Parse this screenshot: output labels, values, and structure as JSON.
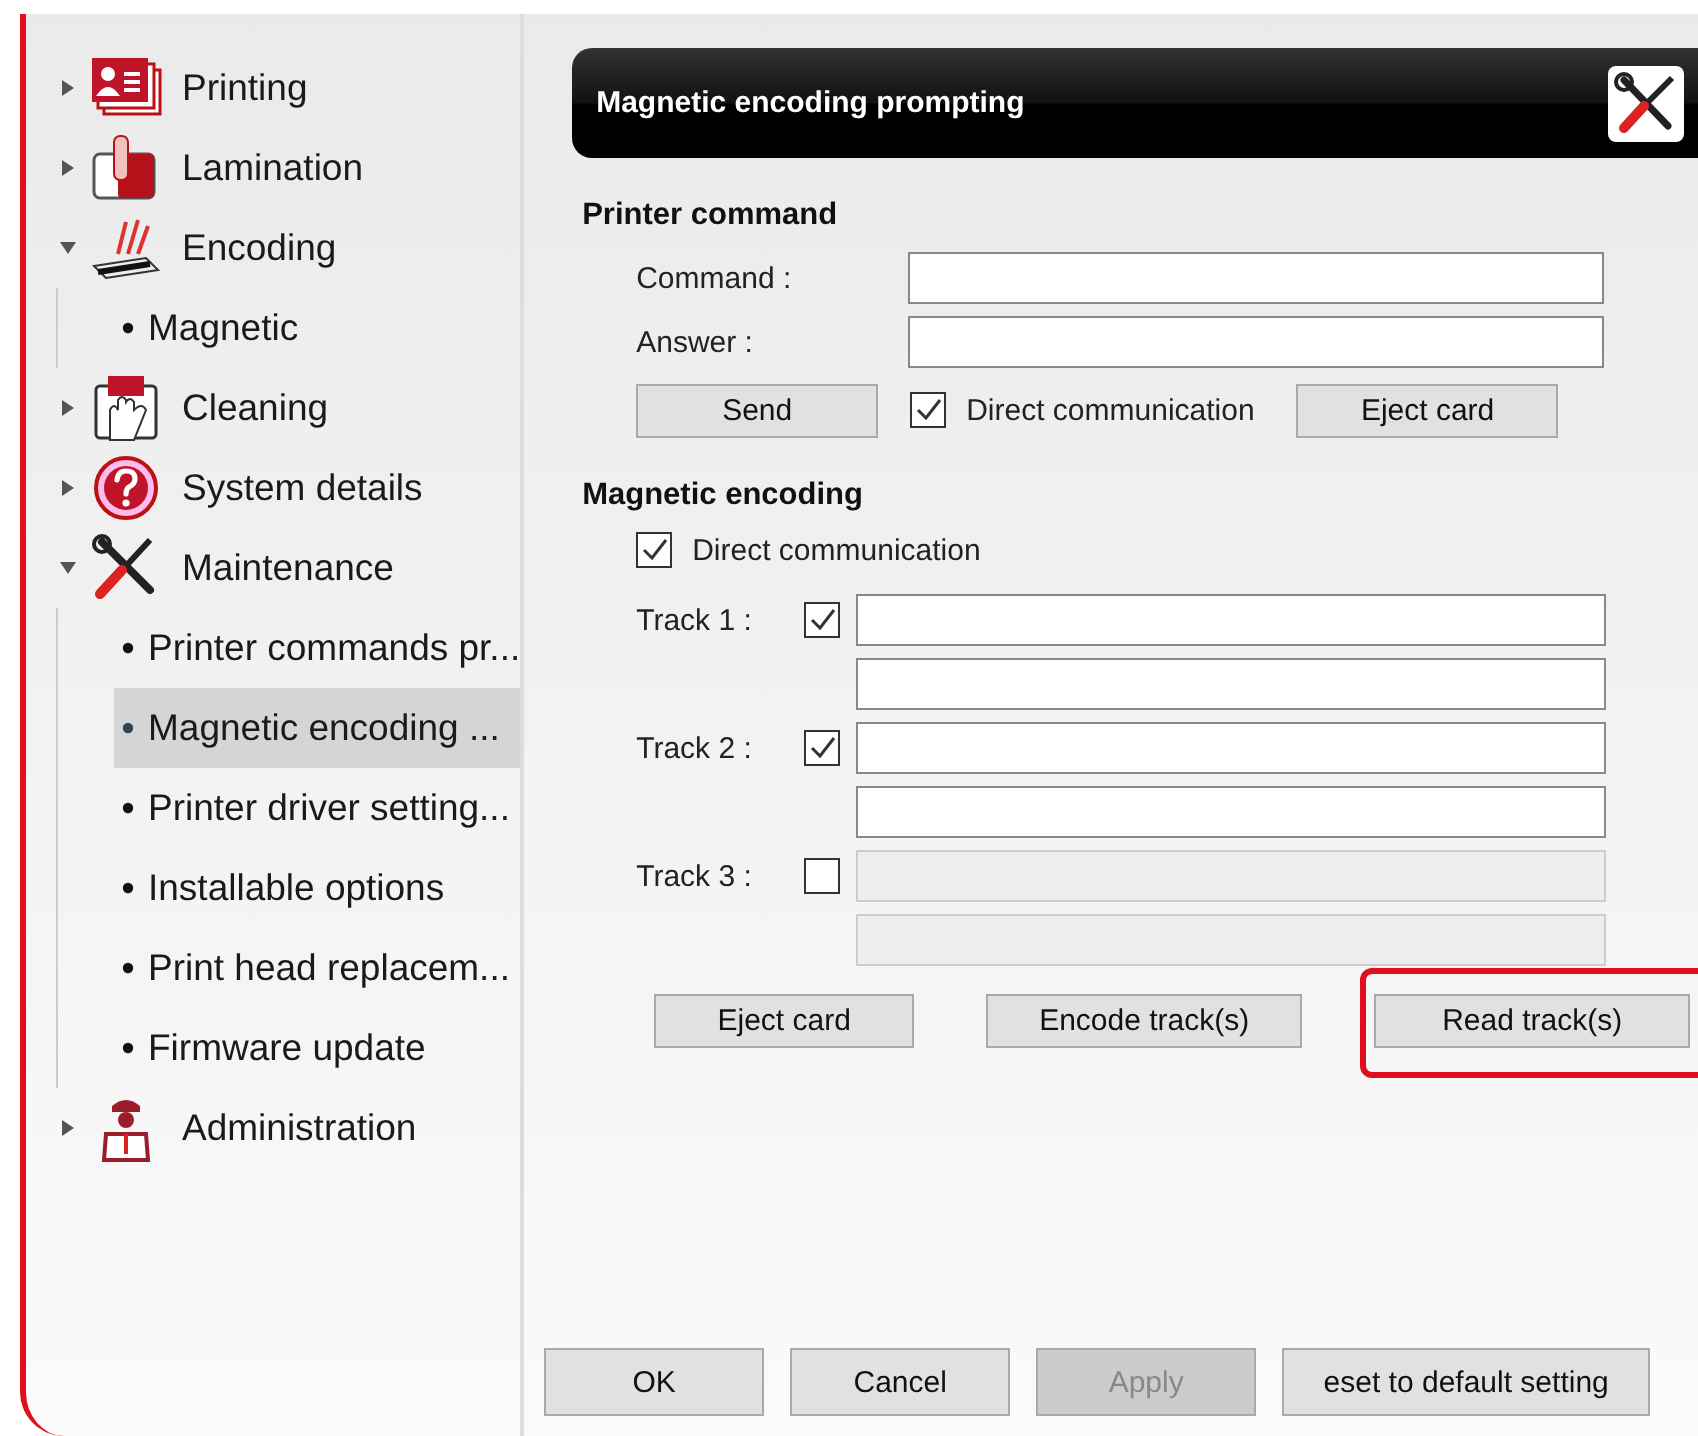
{
  "tree": [
    {
      "label": "Printing",
      "expanded": false
    },
    {
      "label": "Lamination",
      "expanded": false
    },
    {
      "label": "Encoding",
      "expanded": true,
      "children": [
        {
          "label": "Magnetic",
          "selected": false
        }
      ]
    },
    {
      "label": "Cleaning",
      "expanded": false
    },
    {
      "label": "System details",
      "expanded": false
    },
    {
      "label": "Maintenance",
      "expanded": true,
      "children": [
        {
          "label": "Printer commands pr...",
          "selected": false
        },
        {
          "label": "Magnetic encoding ...",
          "selected": true
        },
        {
          "label": "Printer driver setting...",
          "selected": false
        },
        {
          "label": "Installable options",
          "selected": false
        },
        {
          "label": "Print head replacem...",
          "selected": false
        },
        {
          "label": "Firmware update",
          "selected": false
        }
      ]
    },
    {
      "label": "Administration",
      "expanded": false
    }
  ],
  "panel": {
    "title": "Magnetic encoding prompting",
    "printer_command": {
      "heading": "Printer command",
      "command_label": "Command :",
      "answer_label": "Answer :",
      "buttons": [
        {
          "label": "Send",
          "highlighted": false
        }
      ],
      "direct_communication": {
        "label": "Direct communication",
        "checked": true
      },
      "eject_button": {
        "label": "Eject card",
        "highlighted": false
      }
    },
    "magnetic_encoding": {
      "heading": "Magnetic encoding",
      "direct_communication": {
        "label": "Direct communication",
        "checked": true
      },
      "tracks": [
        {
          "label": "Track 1 :",
          "checked": true
        },
        {
          "label": "Track 2 :",
          "checked": true
        },
        {
          "label": "Track 3 :",
          "checked": false
        }
      ],
      "buttons": [
        {
          "label": "Eject card",
          "highlighted": false
        },
        {
          "label": "Encode track(s)",
          "highlighted": false
        },
        {
          "label": "Read track(s)",
          "highlighted": true
        }
      ]
    }
  },
  "footer_buttons": [
    {
      "label": "OK",
      "disabled": false
    },
    {
      "label": "Cancel",
      "disabled": false
    },
    {
      "label": "Apply",
      "disabled": true
    },
    {
      "label": "eset to default setting",
      "disabled": false
    }
  ]
}
